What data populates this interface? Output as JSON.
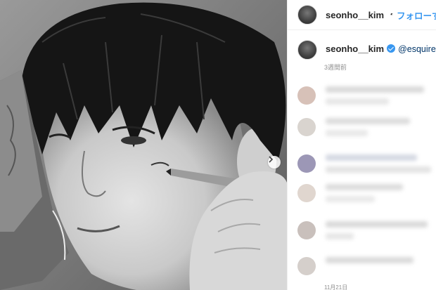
{
  "post": {
    "username": "seonho__kim",
    "follow_label": "フォローする",
    "separator": "•",
    "caption_mention": "@esquire.kore",
    "timestamp": "3週間前",
    "footer_date": "11月21日"
  },
  "icons": {
    "verified": "verified-badge-icon",
    "carousel_next": "chevron-right-icon"
  },
  "colors": {
    "accent": "#3897f0",
    "mention": "#003569",
    "meta": "#8e8e8e",
    "divider": "#efefef"
  }
}
